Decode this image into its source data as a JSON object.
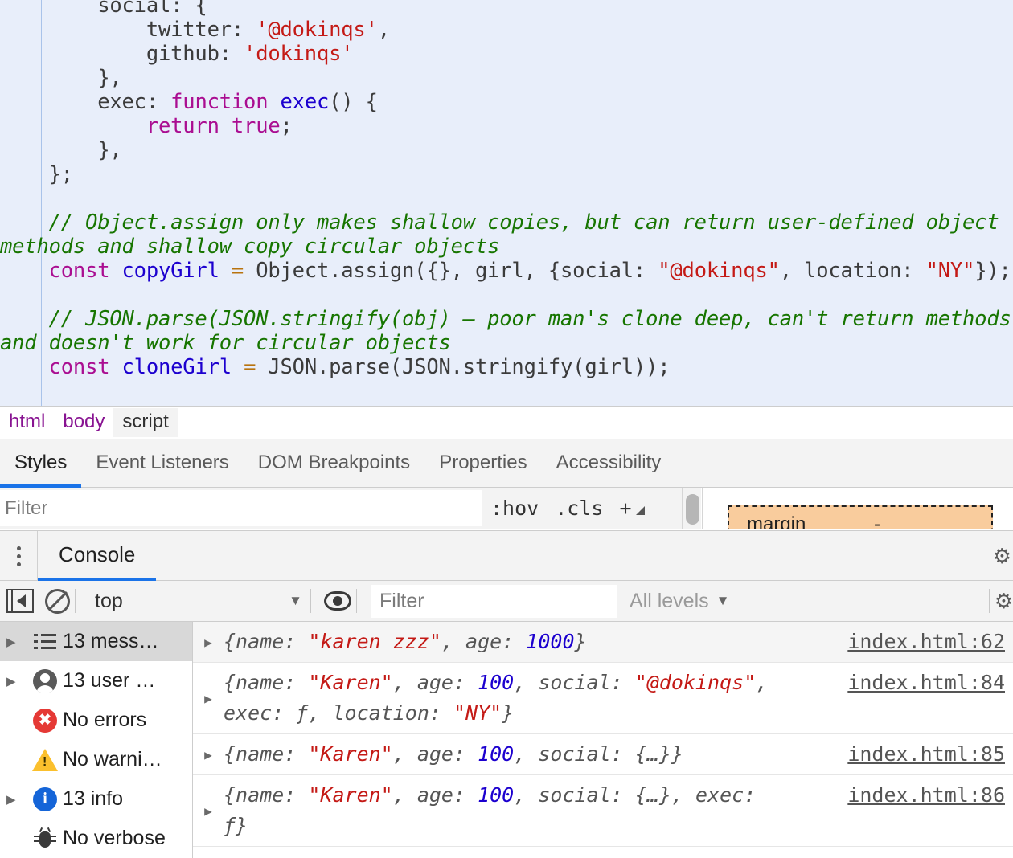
{
  "code_pane": {
    "lines": [
      [
        {
          "t": "plain",
          "s": "        social: {"
        }
      ],
      [
        {
          "t": "plain",
          "s": "            twitter: "
        },
        {
          "t": "str",
          "s": "'@dokinqs'"
        },
        {
          "t": "plain",
          "s": ","
        }
      ],
      [
        {
          "t": "plain",
          "s": "            github: "
        },
        {
          "t": "str",
          "s": "'dokinqs'"
        }
      ],
      [
        {
          "t": "plain",
          "s": "        },"
        }
      ],
      [
        {
          "t": "plain",
          "s": "        exec: "
        },
        {
          "t": "kw",
          "s": "function"
        },
        {
          "t": "plain",
          "s": " "
        },
        {
          "t": "def",
          "s": "exec"
        },
        {
          "t": "plain",
          "s": "() {"
        }
      ],
      [
        {
          "t": "plain",
          "s": "            "
        },
        {
          "t": "kw",
          "s": "return true"
        },
        {
          "t": "plain",
          "s": ";"
        }
      ],
      [
        {
          "t": "plain",
          "s": "        },"
        }
      ],
      [
        {
          "t": "plain",
          "s": "    };"
        }
      ],
      [
        {
          "t": "plain",
          "s": ""
        }
      ],
      [
        {
          "t": "com",
          "s": "    // Object.assign only makes shallow copies, but can return user-defined object methods and shallow copy circular objects"
        }
      ],
      [
        {
          "t": "plain",
          "s": "    "
        },
        {
          "t": "kw",
          "s": "const"
        },
        {
          "t": "plain",
          "s": " "
        },
        {
          "t": "def",
          "s": "copyGirl"
        },
        {
          "t": "plain",
          "s": " "
        },
        {
          "t": "op",
          "s": "="
        },
        {
          "t": "plain",
          "s": " Object.assign({}, girl, {social: "
        },
        {
          "t": "str",
          "s": "\"@dokinqs\""
        },
        {
          "t": "plain",
          "s": ", location: "
        },
        {
          "t": "str",
          "s": "\"NY\""
        },
        {
          "t": "plain",
          "s": "});"
        }
      ],
      [
        {
          "t": "plain",
          "s": ""
        }
      ],
      [
        {
          "t": "com",
          "s": "    // JSON.parse(JSON.stringify(obj) – poor man's clone deep, can't return methods and doesn't work for circular objects"
        }
      ],
      [
        {
          "t": "plain",
          "s": "    "
        },
        {
          "t": "kw",
          "s": "const"
        },
        {
          "t": "plain",
          "s": " "
        },
        {
          "t": "def",
          "s": "cloneGirl"
        },
        {
          "t": "plain",
          "s": " "
        },
        {
          "t": "op",
          "s": "="
        },
        {
          "t": "plain",
          "s": " JSON.parse(JSON.stringify(girl));"
        }
      ]
    ]
  },
  "breadcrumb": {
    "items": [
      {
        "label": "html",
        "selected": false
      },
      {
        "label": "body",
        "selected": false
      },
      {
        "label": "script",
        "selected": true
      }
    ]
  },
  "styles_tabs": {
    "items": [
      {
        "label": "Styles",
        "active": true
      },
      {
        "label": "Event Listeners",
        "active": false
      },
      {
        "label": "DOM Breakpoints",
        "active": false
      },
      {
        "label": "Properties",
        "active": false
      },
      {
        "label": "Accessibility",
        "active": false
      }
    ]
  },
  "styles_toolbar": {
    "filter_placeholder": "Filter",
    "filter_value": "",
    "hov_label": ":hov",
    "cls_label": ".cls",
    "plus_label": "+"
  },
  "box_model": {
    "margin_label": "margin",
    "margin_value": "-",
    "margin_color": "#f9cc9d"
  },
  "console": {
    "tab_label": "Console",
    "more_icon": "more-vertical-icon",
    "sidebar_toggle_icon": "show-console-sidebar-icon",
    "clear_icon": "clear-console-icon",
    "context_value": "top",
    "live_expression_icon": "eye-icon",
    "filter_placeholder": "Filter",
    "filter_value": "",
    "levels_value": "All levels",
    "settings_icon": "gear-icon"
  },
  "console_sidebar": {
    "items": [
      {
        "label": "13 mess…",
        "icon": "list-icon",
        "caret": true,
        "selected": true
      },
      {
        "label": "13 user …",
        "icon": "user-icon",
        "caret": true,
        "selected": false
      },
      {
        "label": "No errors",
        "icon": "error-icon",
        "caret": false,
        "selected": false
      },
      {
        "label": "No warni…",
        "icon": "warning-icon",
        "caret": false,
        "selected": false
      },
      {
        "label": "13 info",
        "icon": "info-icon",
        "caret": true,
        "selected": false
      },
      {
        "label": "No verbose",
        "icon": "verbose-bug-icon",
        "caret": false,
        "selected": false
      }
    ]
  },
  "console_messages": {
    "rows": [
      {
        "selected": true,
        "link": "index.html:62",
        "parts": [
          {
            "t": "key",
            "s": "{name: "
          },
          {
            "t": "str",
            "s": "\"karen zzz\""
          },
          {
            "t": "key",
            "s": ", age: "
          },
          {
            "t": "num",
            "s": "1000"
          },
          {
            "t": "key",
            "s": "}"
          }
        ]
      },
      {
        "selected": false,
        "link": "index.html:84",
        "parts": [
          {
            "t": "key",
            "s": "{name: "
          },
          {
            "t": "str",
            "s": "\"Karen\""
          },
          {
            "t": "key",
            "s": ", age: "
          },
          {
            "t": "num",
            "s": "100"
          },
          {
            "t": "key",
            "s": ", social: "
          },
          {
            "t": "str",
            "s": "\"@dokinqs\""
          },
          {
            "t": "key",
            "s": ", exec: ƒ, location: "
          },
          {
            "t": "str",
            "s": "\"NY\""
          },
          {
            "t": "key",
            "s": "}"
          }
        ]
      },
      {
        "selected": false,
        "link": "index.html:85",
        "parts": [
          {
            "t": "key",
            "s": "{name: "
          },
          {
            "t": "str",
            "s": "\"Karen\""
          },
          {
            "t": "key",
            "s": ", age: "
          },
          {
            "t": "num",
            "s": "100"
          },
          {
            "t": "key",
            "s": ", social: {…}}"
          }
        ]
      },
      {
        "selected": false,
        "link": "index.html:86",
        "parts": [
          {
            "t": "key",
            "s": "{name: "
          },
          {
            "t": "str",
            "s": "\"Karen\""
          },
          {
            "t": "key",
            "s": ", age: "
          },
          {
            "t": "num",
            "s": "100"
          },
          {
            "t": "key",
            "s": ", social: {…}, exec: ƒ}"
          }
        ]
      }
    ]
  }
}
